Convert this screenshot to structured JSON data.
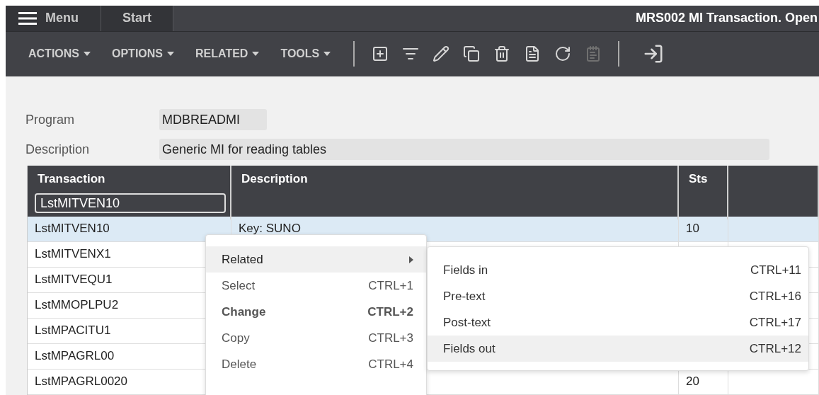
{
  "top_bar": {
    "menu_label": "Menu",
    "tabs": [
      {
        "label": "Start",
        "selected": true
      }
    ],
    "title": "MRS002 MI Transaction. Open"
  },
  "toolbar": {
    "menus": [
      "ACTIONS",
      "OPTIONS",
      "RELATED",
      "TOOLS"
    ],
    "icons": [
      {
        "kind": "add",
        "disabled": false
      },
      {
        "kind": "select",
        "disabled": false
      },
      {
        "kind": "edit",
        "disabled": false
      },
      {
        "kind": "copy",
        "disabled": false
      },
      {
        "kind": "delete",
        "disabled": false
      },
      {
        "kind": "display",
        "disabled": false
      },
      {
        "kind": "refresh",
        "disabled": false
      },
      {
        "kind": "notes",
        "disabled": true
      }
    ],
    "extra_icons": [
      {
        "kind": "enter"
      }
    ]
  },
  "form": {
    "fields": [
      {
        "label": "Program",
        "value": "MDBREADMI",
        "wide": false
      },
      {
        "label": "Description",
        "value": "Generic MI for reading tables",
        "wide": true
      }
    ]
  },
  "table": {
    "columns": [
      "Transaction",
      "Description",
      "Sts"
    ],
    "filter": {
      "value": "LstMITVEN10"
    },
    "rows": [
      {
        "transaction": "LstMITVEN10",
        "description": "Key: SUNO",
        "sts": "10",
        "selected": true
      },
      {
        "transaction": "LstMITVENX1",
        "description": "",
        "sts": "",
        "selected": false
      },
      {
        "transaction": "LstMITVEQU1",
        "description": "",
        "sts": "",
        "selected": false
      },
      {
        "transaction": "LstMMOPLPU2",
        "description": "",
        "sts": "",
        "selected": false
      },
      {
        "transaction": "LstMPACITU1",
        "description": "",
        "sts": "",
        "selected": false
      },
      {
        "transaction": "LstMPAGRL00",
        "description": "",
        "sts": "",
        "selected": false
      },
      {
        "transaction": "LstMPAGRL0020",
        "description": "",
        "sts": "20",
        "selected": false
      }
    ]
  },
  "context_menu": {
    "items": [
      {
        "label": "Related",
        "submenu": true,
        "selected": true,
        "bold": false
      },
      {
        "label": "Select",
        "shortcut": "CTRL+1",
        "submenu": false,
        "selected": false,
        "bold": false
      },
      {
        "label": "Change",
        "shortcut": "CTRL+2",
        "submenu": false,
        "selected": false,
        "bold": true
      },
      {
        "label": "Copy",
        "shortcut": "CTRL+3",
        "submenu": false,
        "selected": false,
        "bold": false
      },
      {
        "label": "Delete",
        "shortcut": "CTRL+4",
        "submenu": false,
        "selected": false,
        "bold": false
      }
    ]
  },
  "submenu": {
    "items": [
      {
        "label": "Fields in",
        "shortcut": "CTRL+11",
        "selected": false
      },
      {
        "label": "Pre-text",
        "shortcut": "CTRL+16",
        "selected": false
      },
      {
        "label": "Post-text",
        "shortcut": "CTRL+17",
        "selected": false
      },
      {
        "label": "Fields out",
        "shortcut": "CTRL+12",
        "selected": true
      }
    ]
  }
}
